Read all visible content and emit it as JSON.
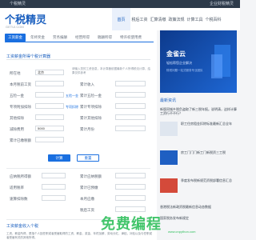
{
  "topbar": {
    "left": "个税精灵",
    "right": "企业财税精灵"
  },
  "header": {
    "logo": "个税精灵",
    "logo_sub": "GETUI.COM"
  },
  "nav": [
    "首页",
    "税后工资",
    "汇算清缴",
    "政策法规",
    "计算工具",
    "个税百科"
  ],
  "tabs": [
    "工资薪金",
    "年终奖金",
    "劳务报酬",
    "经营所得",
    "稿酬所得",
    "特许权使用费"
  ],
  "form": {
    "title": "工资薪金所得个税计算器",
    "city_label": "所在地",
    "city_value": "北京",
    "salary_label": "本月税前工资",
    "salary_value": "",
    "social_label": "五险一金",
    "social_value": "",
    "special_label": "专项附加扣除",
    "special_value": "",
    "other_label": "其他扣除",
    "other_value": "",
    "start_label": "减除费用",
    "start_value": "5000",
    "accum_label": "累计月份",
    "accum_value": "",
    "prev_tax_label": "累计已缴税额",
    "prev_tax_value": "",
    "acc_income_label": "累计收入",
    "acc_income_value": "",
    "acc_social_label": "累计五险一金",
    "acc_social_value": "",
    "acc_special_label": "累计专项扣除",
    "acc_special_value": "",
    "acc_other_label": "累计其他扣除",
    "acc_other_value": "",
    "link1": "五险一金",
    "link2": "专项扣除",
    "note": "请输入您的工资信息，本计算器依据最新个人所得税法计算，结果仅供参考",
    "btn_calc": "计算",
    "btn_reset": "重置",
    "res1": "应纳税所得额",
    "res2": "累计应纳税额",
    "res3": "适用税率",
    "res4": "累计已预缴",
    "res5": "速算扣除数",
    "res6": "本月应缴",
    "res7": "税后工资"
  },
  "section2": {
    "title": "工资薪金收入个税",
    "text": "工资、薪金所得，是指个人因任职或者受雇取得的工资、薪金、奖金、年终加薪、劳动分红、津贴、补贴以及与任职或者受雇有关的其他所得。"
  },
  "side": {
    "banner_title": "金雀云",
    "banner_sub": "轻松帮您企业解决",
    "banner_text": "财税问题一站式服务专业团队",
    "news_head": "最新资讯",
    "news": [
      "新版同城乡税负盗取了新三税年报。说明清，这样计算工资行不不行？",
      "职工住房租金扣除标准最新汇总全年",
      "房工门门门新工门新税资三工税",
      "季度发布税新规范资税部署信息汇总",
      "香港税法新政资税最新信息动态数据",
      "国家税务发布新规定"
    ]
  },
  "watermark": {
    "text": "免费编程",
    "url": "www.cnpython.com"
  }
}
